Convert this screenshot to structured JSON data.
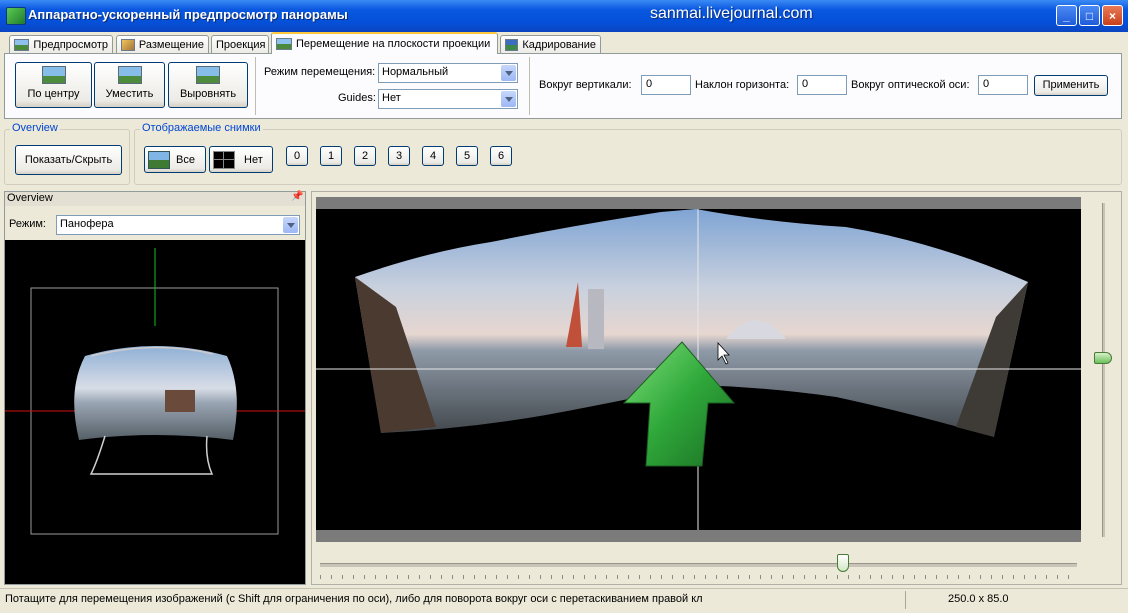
{
  "window": {
    "title": "Аппаратно-ускоренный предпросмотр панорамы",
    "watermark": "sanmai.livejournal.com",
    "controls": {
      "minimize": "_",
      "maximize": "□",
      "close": "×"
    }
  },
  "tabs": [
    {
      "label": "Предпросмотр",
      "icon": "preview-icon"
    },
    {
      "label": "Размещение",
      "icon": "layout-icon"
    },
    {
      "label": "Проекция",
      "icon": ""
    },
    {
      "label": "Перемещение на плоскости проекции",
      "icon": "move-icon",
      "active": true
    },
    {
      "label": "Кадрирование",
      "icon": "crop-icon"
    }
  ],
  "toolbar": {
    "center_label": "По центру",
    "fit_label": "Уместить",
    "align_label": "Выровнять",
    "move_mode_label": "Режим перемещения:",
    "move_mode_value": "Нормальный",
    "guides_label": "Guides:",
    "guides_value": "Нет",
    "yaw_label": "Вокруг вертикали:",
    "yaw_value": "0",
    "pitch_label": "Наклон горизонта:",
    "pitch_value": "0",
    "roll_label": "Вокруг оптической оси:",
    "roll_value": "0",
    "apply_label": "Применить"
  },
  "images_row": {
    "overview_group": "Overview",
    "show_hide_label": "Показать/Скрыть",
    "displayed_group": "Отображаемые снимки",
    "all_label": "Все",
    "none_label": "Нет",
    "numbers": [
      "0",
      "1",
      "2",
      "3",
      "4",
      "5",
      "6"
    ]
  },
  "overview": {
    "title": "Overview",
    "mode_label": "Режим:",
    "mode_value": "Панофера"
  },
  "status": {
    "hint": "Потащите для перемещения изображений (с Shift для ограничения по оси), либо для поворота вокруг оси с перетаскиванием правой кл",
    "fov": "250.0 x 85.0"
  },
  "colors": {
    "titlebar": "#0550d8",
    "arrow_green": "#2fa83a",
    "guide_red": "#d01010",
    "guide_green": "#10c020"
  }
}
